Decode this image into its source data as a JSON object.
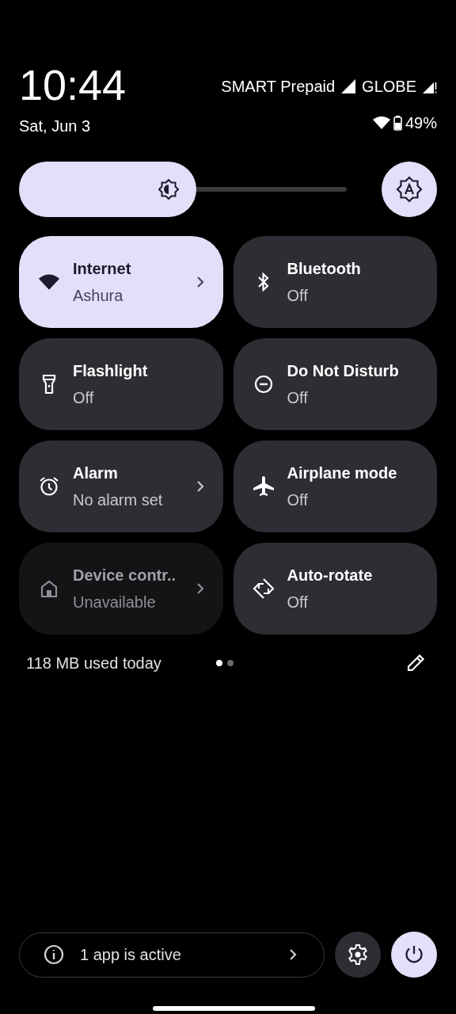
{
  "status": {
    "time": "10:44",
    "date": "Sat, Jun 3",
    "carrier_1": "SMART Prepaid",
    "carrier_2": "GLOBE",
    "battery": "49%"
  },
  "brightness": {
    "level": 0.54,
    "auto": true
  },
  "tiles": [
    {
      "title": "Internet",
      "subtitle": "Ashura",
      "on": true,
      "disabled": false,
      "chevron": true
    },
    {
      "title": "Bluetooth",
      "subtitle": "Off",
      "on": false,
      "disabled": false,
      "chevron": false
    },
    {
      "title": "Flashlight",
      "subtitle": "Off",
      "on": false,
      "disabled": false,
      "chevron": false
    },
    {
      "title": "Do Not Disturb",
      "subtitle": "Off",
      "on": false,
      "disabled": false,
      "chevron": false
    },
    {
      "title": "Alarm",
      "subtitle": "No alarm set",
      "on": false,
      "disabled": false,
      "chevron": true
    },
    {
      "title": "Airplane mode",
      "subtitle": "Off",
      "on": false,
      "disabled": false,
      "chevron": false
    },
    {
      "title": "Device contr..",
      "subtitle": "Unavailable",
      "on": false,
      "disabled": true,
      "chevron": true
    },
    {
      "title": "Auto-rotate",
      "subtitle": "Off",
      "on": false,
      "disabled": false,
      "chevron": false
    }
  ],
  "data_usage": "118 MB used today",
  "pages": [
    {
      "selected": true
    },
    {
      "selected": false
    }
  ],
  "footer": {
    "active_apps": "1 app is active"
  }
}
